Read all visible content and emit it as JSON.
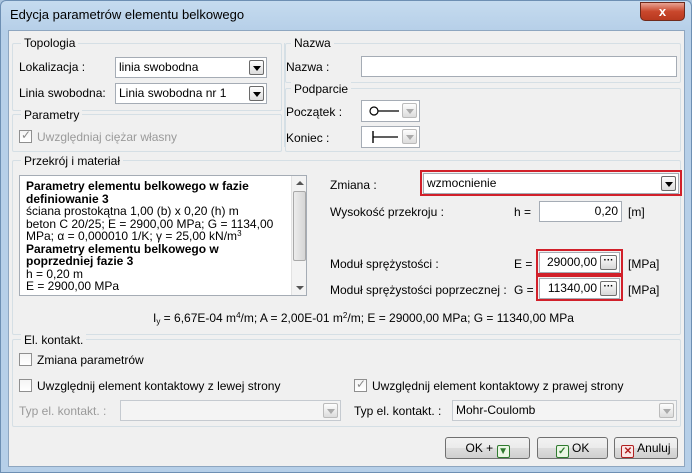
{
  "window": {
    "title": "Edycja parametrów elementu belkowego",
    "close_label": "x"
  },
  "topology": {
    "legend": "Topologia",
    "localization_label": "Lokalizacja :",
    "localization_value": "linia swobodna",
    "line_label": "Linia swobodna:",
    "line_value": "Linia swobodna nr 1"
  },
  "name_section": {
    "legend": "Nazwa",
    "name_label": "Nazwa :",
    "name_value": ""
  },
  "parameters": {
    "legend": "Parametry",
    "self_weight_label": "Uwzględniaj ciężar własny",
    "self_weight_checked": true
  },
  "support": {
    "legend": "Podparcie",
    "start_label": "Początek :",
    "end_label": "Koniec :"
  },
  "section": {
    "legend": "Przekrój i materiał",
    "memo": {
      "heading1": "Parametry elementu belkowego w fazie definiowanie 3",
      "line1": "ściana prostokątna 1,00 (b) x 0,20 (h) m",
      "line2a": "beton C 20/25; E = 2900,00 MPa; G = 1134,00 MPa; α = 0,000010 1/K; γ = 25,00 kN/m",
      "line2_sup": "3",
      "heading2": "Parametry elementu belkowego w poprzedniej fazie 3",
      "line3": "h = 0,20 m",
      "line4": "E = 2900,00 MPa"
    },
    "change_label": "Zmiana :",
    "change_value": "wzmocnienie",
    "height_label": "Wysokość przekroju :",
    "height_symbol": "h =",
    "height_value": "0,20",
    "height_unit": "[m]",
    "modulus_label": "Moduł sprężystości :",
    "modulus_symbol": "E =",
    "modulus_value": "29000,00",
    "modulus_unit": "[MPa]",
    "shear_label": "Moduł sprężystości poprzecznej :",
    "shear_symbol": "G =",
    "shear_value": "11340,00",
    "shear_unit": "[MPa]",
    "summary": {
      "i_sym": "I",
      "i_sub": "y",
      "i_val": " = 6,67E-04 m",
      "i_sup": "4",
      "a_part": "/m; A = 2,00E-01 m",
      "a_sup": "2",
      "rest": "/m; E = 29000,00 MPa; G = 11340,00 MPa"
    }
  },
  "contact": {
    "legend": "El. kontakt.",
    "change_params_label": "Zmiana parametrów",
    "left_label": "Uwzględnij element kontaktowy z lewej strony",
    "right_label": "Uwzględnij element kontaktowy z prawej strony",
    "left_type_label": "Typ el. kontakt. :",
    "left_type_value": "",
    "right_type_label": "Typ el. kontakt. :",
    "right_type_value": "Mohr-Coulomb"
  },
  "buttons": {
    "ok_plus": "OK +",
    "ok": "OK",
    "cancel": "Anuluj"
  },
  "colors": {
    "highlight": "#d1202a",
    "window_frame": "#b6cfe8",
    "client_bg": "#f0f0f0"
  }
}
